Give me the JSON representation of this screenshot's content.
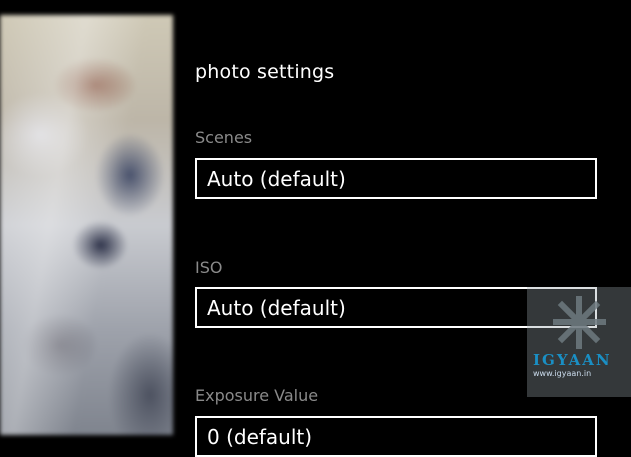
{
  "screen": {
    "title": "photo settings"
  },
  "settings": [
    {
      "label": "Scenes",
      "value": "Auto (default)"
    },
    {
      "label": "ISO",
      "value": "Auto (default)"
    },
    {
      "label": "Exposure Value",
      "value": "0 (default)"
    }
  ],
  "watermark": {
    "brand": "IGYAAN",
    "url": "www.igyaan.in"
  },
  "colors": {
    "background": "#000000",
    "label": "#8a8a8a",
    "text": "#ffffff",
    "watermark_brand": "#1a8fc4"
  }
}
